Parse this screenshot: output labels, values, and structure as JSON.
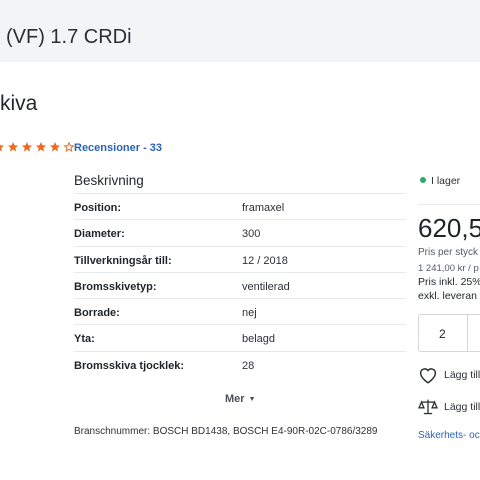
{
  "header": {
    "vehicle_title": "(VF) 1.7 CRDi"
  },
  "product": {
    "title": "kiva",
    "rating": 4,
    "rating_max": 5,
    "reviews_label": "Recensioner - 33"
  },
  "description": {
    "title": "Beskrivning",
    "specs": [
      {
        "key": "Position:",
        "value": "framaxel"
      },
      {
        "key": "Diameter:",
        "value": "300"
      },
      {
        "key": "Tillverkningsår till:",
        "value": "12 / 2018"
      },
      {
        "key": "Bromsskivetyp:",
        "value": "ventilerad"
      },
      {
        "key": "Borrade:",
        "value": "nej"
      },
      {
        "key": "Yta:",
        "value": "belagd"
      },
      {
        "key": "Bromsskiva tjocklek:",
        "value": "28"
      }
    ],
    "more_label": "Mer",
    "branch_numbers": "Branschnummer: BOSCH BD1438, BOSCH E4-90R-02C-0786/3289"
  },
  "purchase": {
    "stock_label": "I lager",
    "stock_color": "#2fa86a",
    "price": "620,5",
    "price_per_label": "Pris per styck",
    "price_alt": "1 241,00 kr / p",
    "vat_label": "Pris inkl. 25%",
    "delivery_label": "exkl. leveran",
    "quantity": "2",
    "favorite_label": "Lägg till",
    "compare_label": "Lägg till",
    "safety_label": "Säkerhets- oc"
  },
  "colors": {
    "star": "#f06a1d",
    "link": "#2a63b8",
    "header_bg": "#f3f4f6"
  }
}
